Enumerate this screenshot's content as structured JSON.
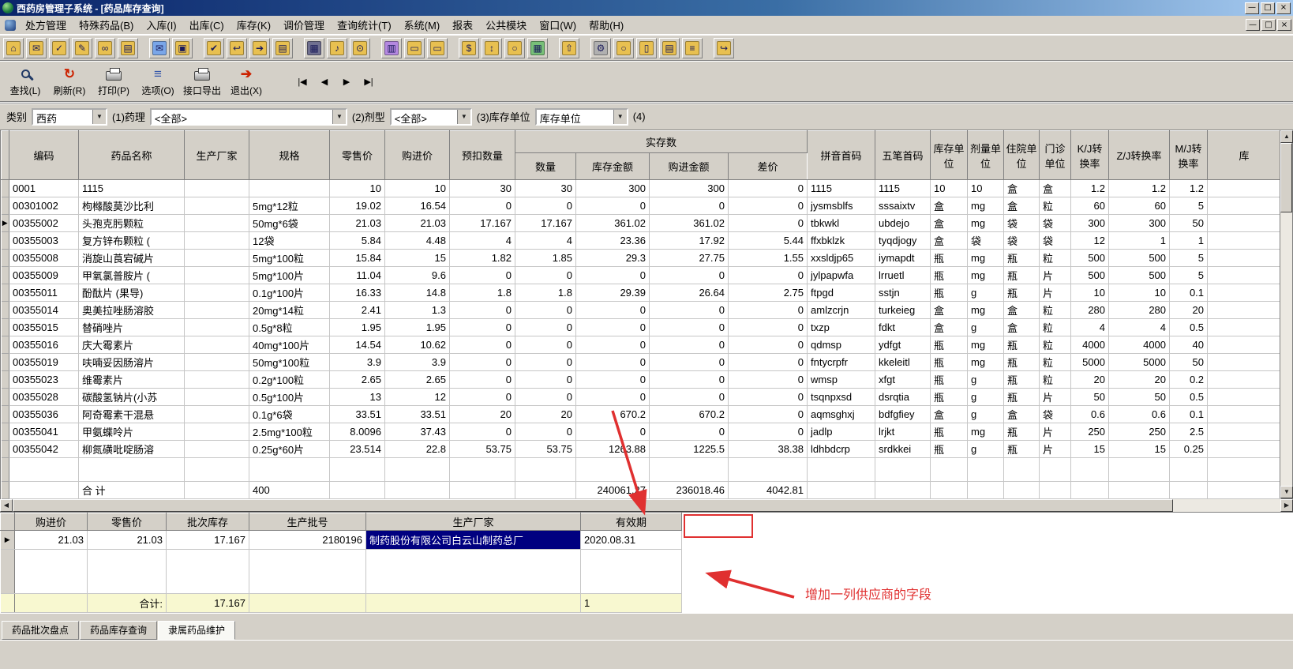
{
  "window": {
    "title": "西药房管理子系统 - [药品库存查询]",
    "controls": {
      "min": "—",
      "restore": "□",
      "close": "×"
    }
  },
  "menu": {
    "items": [
      "处方管理",
      "特殊药品(B)",
      "入库(I)",
      "出库(C)",
      "库存(K)",
      "调价管理",
      "查询统计(T)",
      "系统(M)",
      "报表",
      "公共模块",
      "窗口(W)",
      "帮助(H)"
    ]
  },
  "toolbar1": {
    "groups": [
      [
        {
          "n": "home",
          "g": "⌂",
          "c": "#e8c050"
        },
        {
          "n": "mail",
          "g": "✉",
          "c": "#e8c050"
        },
        {
          "n": "check",
          "g": "✓",
          "c": "#e8c050"
        },
        {
          "n": "edit",
          "g": "✎",
          "c": "#e8c050"
        },
        {
          "n": "binoculars",
          "g": "∞",
          "c": "#e8c050"
        },
        {
          "n": "scan",
          "g": "▤",
          "c": "#e8c050"
        }
      ],
      [
        {
          "n": "mail-open",
          "g": "✉",
          "c": "#7aa6e8"
        },
        {
          "n": "copy",
          "g": "▣",
          "c": "#e8c050"
        }
      ],
      [
        {
          "n": "doc-check",
          "g": "✔",
          "c": "#e8c050"
        },
        {
          "n": "doc-back",
          "g": "↩",
          "c": "#e8c050"
        },
        {
          "n": "doc-go",
          "g": "➔",
          "c": "#e8c050"
        },
        {
          "n": "doc-print",
          "g": "▤",
          "c": "#e8c050"
        }
      ],
      [
        {
          "n": "barcode",
          "g": "▦",
          "c": "#707090"
        },
        {
          "n": "bell",
          "g": "♪",
          "c": "#e8c050"
        },
        {
          "n": "clock",
          "g": "⊙",
          "c": "#e8c050"
        }
      ],
      [
        {
          "n": "cabinet",
          "g": "▥",
          "c": "#b488e0"
        },
        {
          "n": "folder-search",
          "g": "▭",
          "c": "#e8c050"
        },
        {
          "n": "folder",
          "g": "▭",
          "c": "#e8c050"
        }
      ],
      [
        {
          "n": "money",
          "g": "$",
          "c": "#e8c050"
        },
        {
          "n": "thermometer",
          "g": "↕",
          "c": "#e8c050"
        },
        {
          "n": "search",
          "g": "○",
          "c": "#e8c050"
        },
        {
          "n": "grid",
          "g": "▦",
          "c": "#78c078"
        }
      ],
      [
        {
          "n": "export",
          "g": "⇧",
          "c": "#e8c050"
        }
      ],
      [
        {
          "n": "tools",
          "g": "⚙",
          "c": "#b0b0b0"
        },
        {
          "n": "zoom",
          "g": "○",
          "c": "#e8c050"
        },
        {
          "n": "page",
          "g": "▯",
          "c": "#e8c050"
        },
        {
          "n": "cards",
          "g": "▤",
          "c": "#e8c050"
        },
        {
          "n": "flow",
          "g": "≡",
          "c": "#e8c050"
        }
      ],
      [
        {
          "n": "exit-small",
          "g": "↪",
          "c": "#e8c050"
        }
      ]
    ]
  },
  "toolbar2": {
    "buttons": [
      {
        "label": "查找(L)"
      },
      {
        "label": "刷新(R)"
      },
      {
        "label": "打印(P)"
      },
      {
        "label": "选项(O)"
      },
      {
        "label": "接口导出"
      },
      {
        "label": "退出(X)"
      }
    ],
    "nav": [
      "|◀",
      "◀",
      "▶",
      "▶|"
    ]
  },
  "filters": {
    "category_label": "类别",
    "category_value": "西药",
    "pharmacology_label": "(1)药理",
    "pharmacology_value": "<全部>",
    "dosage_label": "(2)剂型",
    "dosage_value": "<全部>",
    "unit_label": "(3)库存单位",
    "unit_value": "库存单位",
    "four_label": "(4)"
  },
  "main_grid": {
    "headers": {
      "code": "编码",
      "name": "药品名称",
      "manufacturer": "生产厂家",
      "spec": "规格",
      "retail": "零售价",
      "purchase": "购进价",
      "withhold": "预扣数量",
      "actual": "实存数",
      "qty": "数量",
      "stock_amount": "库存金额",
      "purchase_amount": "购进金额",
      "diff": "差价",
      "pinyin": "拼音首码",
      "wubi": "五笔首码",
      "stock_unit": "库存单位",
      "dose_unit": "剂量单位",
      "inpatient_unit": "住院单位",
      "outpatient_unit": "门诊单位",
      "kj": "K/J转换率",
      "zj": "Z/J转换率",
      "mj": "M/J转换率",
      "more": "库"
    },
    "rows": [
      [
        "",
        "0001",
        "1115",
        "",
        "",
        "10",
        "10",
        "30",
        "30",
        "300",
        "300",
        "0",
        "1115",
        "1115",
        "10",
        "10",
        "盒",
        "盒",
        "1.2",
        "1.2",
        "1.2",
        ""
      ],
      [
        "",
        "00301002",
        "枸橼酸莫沙比利",
        "",
        "5mg*12粒",
        "19.02",
        "16.54",
        "0",
        "0",
        "0",
        "0",
        "0",
        "jysmsblfs",
        "sssaixtv",
        "盒",
        "mg",
        "盒",
        "粒",
        "60",
        "60",
        "5",
        ""
      ],
      [
        "▶",
        "00355002",
        "头孢克肟颗粒",
        "",
        "50mg*6袋",
        "21.03",
        "21.03",
        "17.167",
        "17.167",
        "361.02",
        "361.02",
        "0",
        "tbkwkl",
        "ubdejo",
        "盒",
        "mg",
        "袋",
        "袋",
        "300",
        "300",
        "50",
        ""
      ],
      [
        "",
        "00355003",
        "复方锌布颗粒 (",
        "",
        "12袋",
        "5.84",
        "4.48",
        "4",
        "4",
        "23.36",
        "17.92",
        "5.44",
        "ffxbklzk",
        "tyqdjogy",
        "盒",
        "袋",
        "袋",
        "袋",
        "12",
        "1",
        "1",
        ""
      ],
      [
        "",
        "00355008",
        "消旋山莨宕碱片",
        "",
        "5mg*100粒",
        "15.84",
        "15",
        "1.82",
        "1.85",
        "29.3",
        "27.75",
        "1.55",
        "xxsldjp65",
        "iymapdt",
        "瓶",
        "mg",
        "瓶",
        "粒",
        "500",
        "500",
        "5",
        ""
      ],
      [
        "",
        "00355009",
        "甲氧氯普胺片 (",
        "",
        "5mg*100片",
        "11.04",
        "9.6",
        "0",
        "0",
        "0",
        "0",
        "0",
        "jylpapwfa",
        "lrruetl",
        "瓶",
        "mg",
        "瓶",
        "片",
        "500",
        "500",
        "5",
        ""
      ],
      [
        "",
        "00355011",
        "酚酞片 (果导)",
        "",
        "0.1g*100片",
        "16.33",
        "14.8",
        "1.8",
        "1.8",
        "29.39",
        "26.64",
        "2.75",
        "ftpgd",
        "sstjn",
        "瓶",
        "g",
        "瓶",
        "片",
        "10",
        "10",
        "0.1",
        ""
      ],
      [
        "",
        "00355014",
        "奥美拉唑肠溶胶",
        "",
        "20mg*14粒",
        "2.41",
        "1.3",
        "0",
        "0",
        "0",
        "0",
        "0",
        "amlzcrjn",
        "turkeieg",
        "盒",
        "mg",
        "盒",
        "粒",
        "280",
        "280",
        "20",
        ""
      ],
      [
        "",
        "00355015",
        "替硝唑片",
        "",
        "0.5g*8粒",
        "1.95",
        "1.95",
        "0",
        "0",
        "0",
        "0",
        "0",
        "txzp",
        "fdkt",
        "盒",
        "g",
        "盒",
        "粒",
        "4",
        "4",
        "0.5",
        ""
      ],
      [
        "",
        "00355016",
        "庆大霉素片",
        "",
        "40mg*100片",
        "14.54",
        "10.62",
        "0",
        "0",
        "0",
        "0",
        "0",
        "qdmsp",
        "ydfgt",
        "瓶",
        "mg",
        "瓶",
        "粒",
        "4000",
        "4000",
        "40",
        ""
      ],
      [
        "",
        "00355019",
        "呋喃妥因肠溶片",
        "",
        "50mg*100粒",
        "3.9",
        "3.9",
        "0",
        "0",
        "0",
        "0",
        "0",
        "fntycrpfr",
        "kkeleitl",
        "瓶",
        "mg",
        "瓶",
        "粒",
        "5000",
        "5000",
        "50",
        ""
      ],
      [
        "",
        "00355023",
        "维霉素片",
        "",
        "0.2g*100粒",
        "2.65",
        "2.65",
        "0",
        "0",
        "0",
        "0",
        "0",
        "wmsp",
        "xfgt",
        "瓶",
        "g",
        "瓶",
        "粒",
        "20",
        "20",
        "0.2",
        ""
      ],
      [
        "",
        "00355028",
        "碳酸氢钠片(小苏",
        "",
        "0.5g*100片",
        "13",
        "12",
        "0",
        "0",
        "0",
        "0",
        "0",
        "tsqnpxsd",
        "dsrqtia",
        "瓶",
        "g",
        "瓶",
        "片",
        "50",
        "50",
        "0.5",
        ""
      ],
      [
        "",
        "00355036",
        "阿奇霉素干混悬",
        "",
        "0.1g*6袋",
        "33.51",
        "33.51",
        "20",
        "20",
        "670.2",
        "670.2",
        "0",
        "aqmsghxj",
        "bdfgfiey",
        "盒",
        "g",
        "盒",
        "袋",
        "0.6",
        "0.6",
        "0.1",
        ""
      ],
      [
        "",
        "00355041",
        "甲氨蝶呤片",
        "",
        "2.5mg*100粒",
        "8.0096",
        "37.43",
        "0",
        "0",
        "0",
        "0",
        "0",
        "jadlp",
        "lrjkt",
        "瓶",
        "mg",
        "瓶",
        "片",
        "250",
        "250",
        "2.5",
        ""
      ],
      [
        "",
        "00355042",
        "柳氮磺吡啶肠溶",
        "",
        "0.25g*60片",
        "23.514",
        "22.8",
        "53.75",
        "53.75",
        "1263.88",
        "1225.5",
        "38.38",
        "ldhbdcrp",
        "srdkkei",
        "瓶",
        "g",
        "瓶",
        "片",
        "15",
        "15",
        "0.25",
        ""
      ]
    ],
    "total": {
      "label": "合  计",
      "spec_col": "400",
      "stock_amount": "240061.27",
      "purchase_amount": "236018.46",
      "diff": "4042.81"
    }
  },
  "batch_grid": {
    "headers": {
      "purchase": "购进价",
      "retail": "零售价",
      "stock": "批次库存",
      "batch_no": "生产批号",
      "manufacturer": "生产厂家",
      "expiry": "有效期"
    },
    "row": {
      "indicator": "▶",
      "purchase": "21.03",
      "retail": "21.03",
      "stock": "17.167",
      "batch_no": "2180196",
      "manufacturer": "制药股份有限公司白云山制药总厂",
      "expiry": "2020.08.31"
    },
    "total": {
      "label": "合计:",
      "stock": "17.167",
      "count": "1"
    }
  },
  "annotation": {
    "note": "增加一列供应商的字段",
    "color": "#e03030"
  },
  "tabs": [
    {
      "label": "药品批次盘点",
      "active": false
    },
    {
      "label": "药品库存查询",
      "active": false
    },
    {
      "label": "隶属药品维护",
      "active": true
    }
  ]
}
